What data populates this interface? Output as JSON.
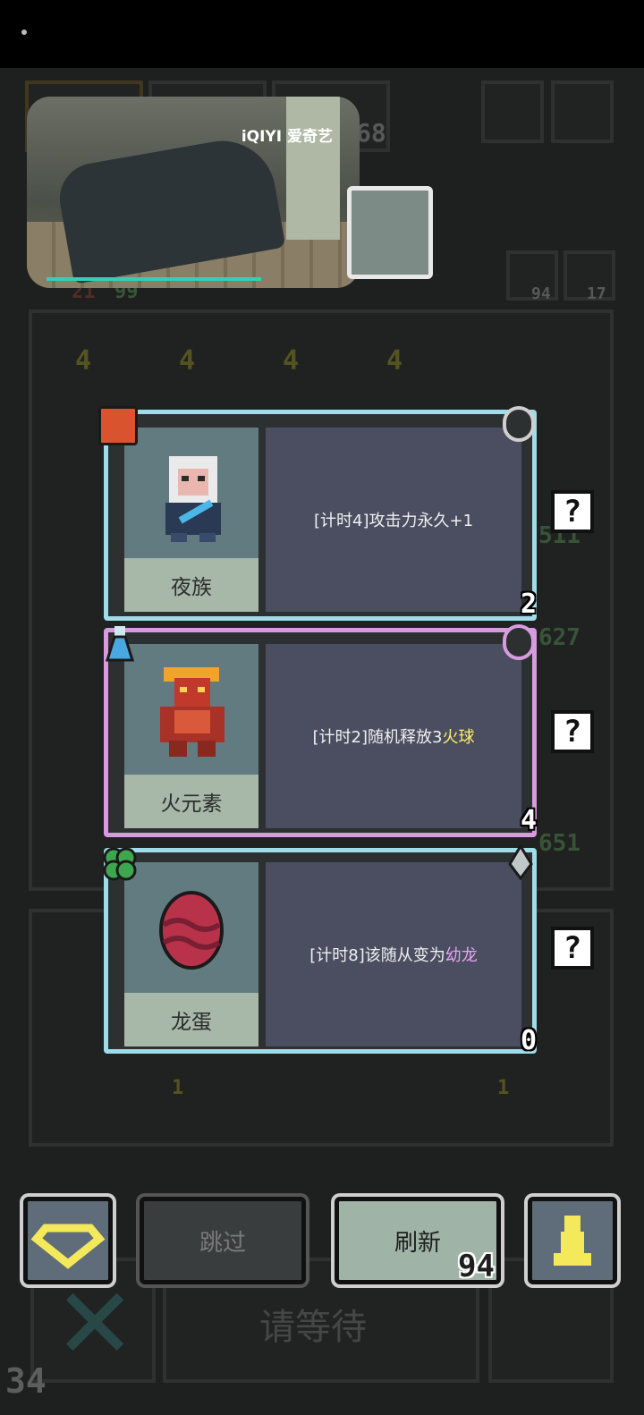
{
  "video": {
    "logo": "iQIYI 爱奇艺"
  },
  "background": {
    "top_counter": "68",
    "side_counts": [
      "94",
      "17"
    ],
    "left_counts": [
      "21",
      "99"
    ],
    "unit_levels": [
      "4",
      "4",
      "4",
      "4"
    ],
    "right_nums": [
      "511",
      "627",
      "651"
    ],
    "bottom_left_count": "34",
    "inventory_counts": [
      "1",
      "1"
    ],
    "wait_label": "请等待"
  },
  "cards": [
    {
      "name": "夜族",
      "desc_pre": "[计时4]攻击力永久+1",
      "desc_hl": "",
      "count": "2",
      "badge": "fox-icon",
      "corner": "bow-icon",
      "hl_color": "#ffffff"
    },
    {
      "name": "火元素",
      "desc_pre": "[计时2]随机释放3",
      "desc_hl": "火球",
      "count": "4",
      "badge": "potion-icon",
      "corner": "bow-icon",
      "hl_color": "#fff066"
    },
    {
      "name": "龙蛋",
      "desc_pre": "[计时8]该随从变为",
      "desc_hl": "幼龙",
      "count": "0",
      "badge": "clover-icon",
      "corner": "sword-icon",
      "hl_color": "#e6a6f1"
    }
  ],
  "buttons": {
    "skip": "跳过",
    "refresh": "刷新",
    "refresh_cost": "94",
    "gem": "gem-icon",
    "pawn": "pawn-icon",
    "help": "?"
  },
  "colors": {
    "card_border": "#9fdde9",
    "card_border_selected": "#d79be0",
    "accent_yellow": "#fff066"
  }
}
